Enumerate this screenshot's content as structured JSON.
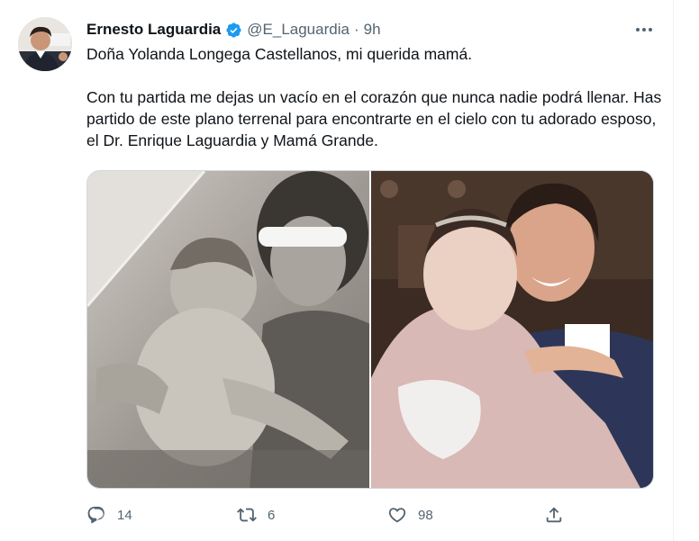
{
  "author": {
    "name": "Ernesto Laguardia",
    "handle": "@E_Laguardia",
    "separator": "·",
    "time": "9h",
    "verified_color": "#1d9bf0"
  },
  "tweet": {
    "paragraph1": "Doña Yolanda Longega Castellanos, mi querida mamá.",
    "paragraph2": "Con tu partida me dejas un vacío en el corazón que nunca nadie podrá llenar. Has partido de este plano terrenal para encontrarte en el cielo con tu adorado esposo, el Dr. Enrique Laguardia y Mamá Grande."
  },
  "media": [
    {
      "icon": "vintage-sepia-photo"
    },
    {
      "icon": "color-portrait-photo"
    }
  ],
  "actions": {
    "replies": "14",
    "retweets": "6",
    "likes": "98"
  },
  "colors": {
    "text": "#0f1419",
    "secondary": "#536471",
    "accent": "#1d9bf0"
  }
}
